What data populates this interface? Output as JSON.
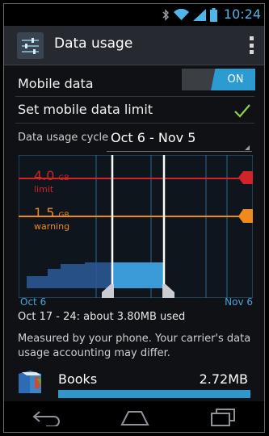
{
  "status": {
    "time": "10:24"
  },
  "actionbar": {
    "title": "Data usage",
    "app_icon": "settings-sliders-icon",
    "overflow_icon": "overflow-menu-icon"
  },
  "mobile_data": {
    "label": "Mobile data",
    "toggle_state": "ON"
  },
  "data_limit": {
    "label": "Set mobile data limit",
    "checked": true
  },
  "cycle": {
    "label": "Data usage cycle",
    "value": "Oct 6 - Nov 5"
  },
  "chart": {
    "limit_value": "4.0",
    "limit_unit": "GB",
    "limit_label": "limit",
    "warning_value": "1.5",
    "warning_unit": "GB",
    "warning_label": "warning",
    "start_date": "Oct 6",
    "end_date": "Nov 6",
    "colors": {
      "limit": "#d0232a",
      "warning": "#f08a1c",
      "usage": "#2e97cc",
      "grid": "#2c6a96"
    }
  },
  "chart_data": {
    "type": "area",
    "x": [
      "Oct 6",
      "Oct 9",
      "Oct 11",
      "Oct 13",
      "Oct 17",
      "Oct 24",
      "Nov 6"
    ],
    "values_gb": [
      0.0,
      0.15,
      0.25,
      0.35,
      0.4,
      0.4,
      0.4
    ],
    "limit_gb": 4.0,
    "warning_gb": 1.5,
    "selected_range": [
      "Oct 17",
      "Oct 24"
    ]
  },
  "summary": "Oct 17 - 24: about 3.80MB used",
  "note": "Measured by your phone. Your carrier's data usage accounting may differ.",
  "apps": [
    {
      "name": "Books",
      "size": "2.72MB",
      "share": 1.0,
      "icon": "books-icon"
    }
  ],
  "navbar": {
    "back": "back-icon",
    "home": "home-icon",
    "recents": "recents-icon"
  }
}
